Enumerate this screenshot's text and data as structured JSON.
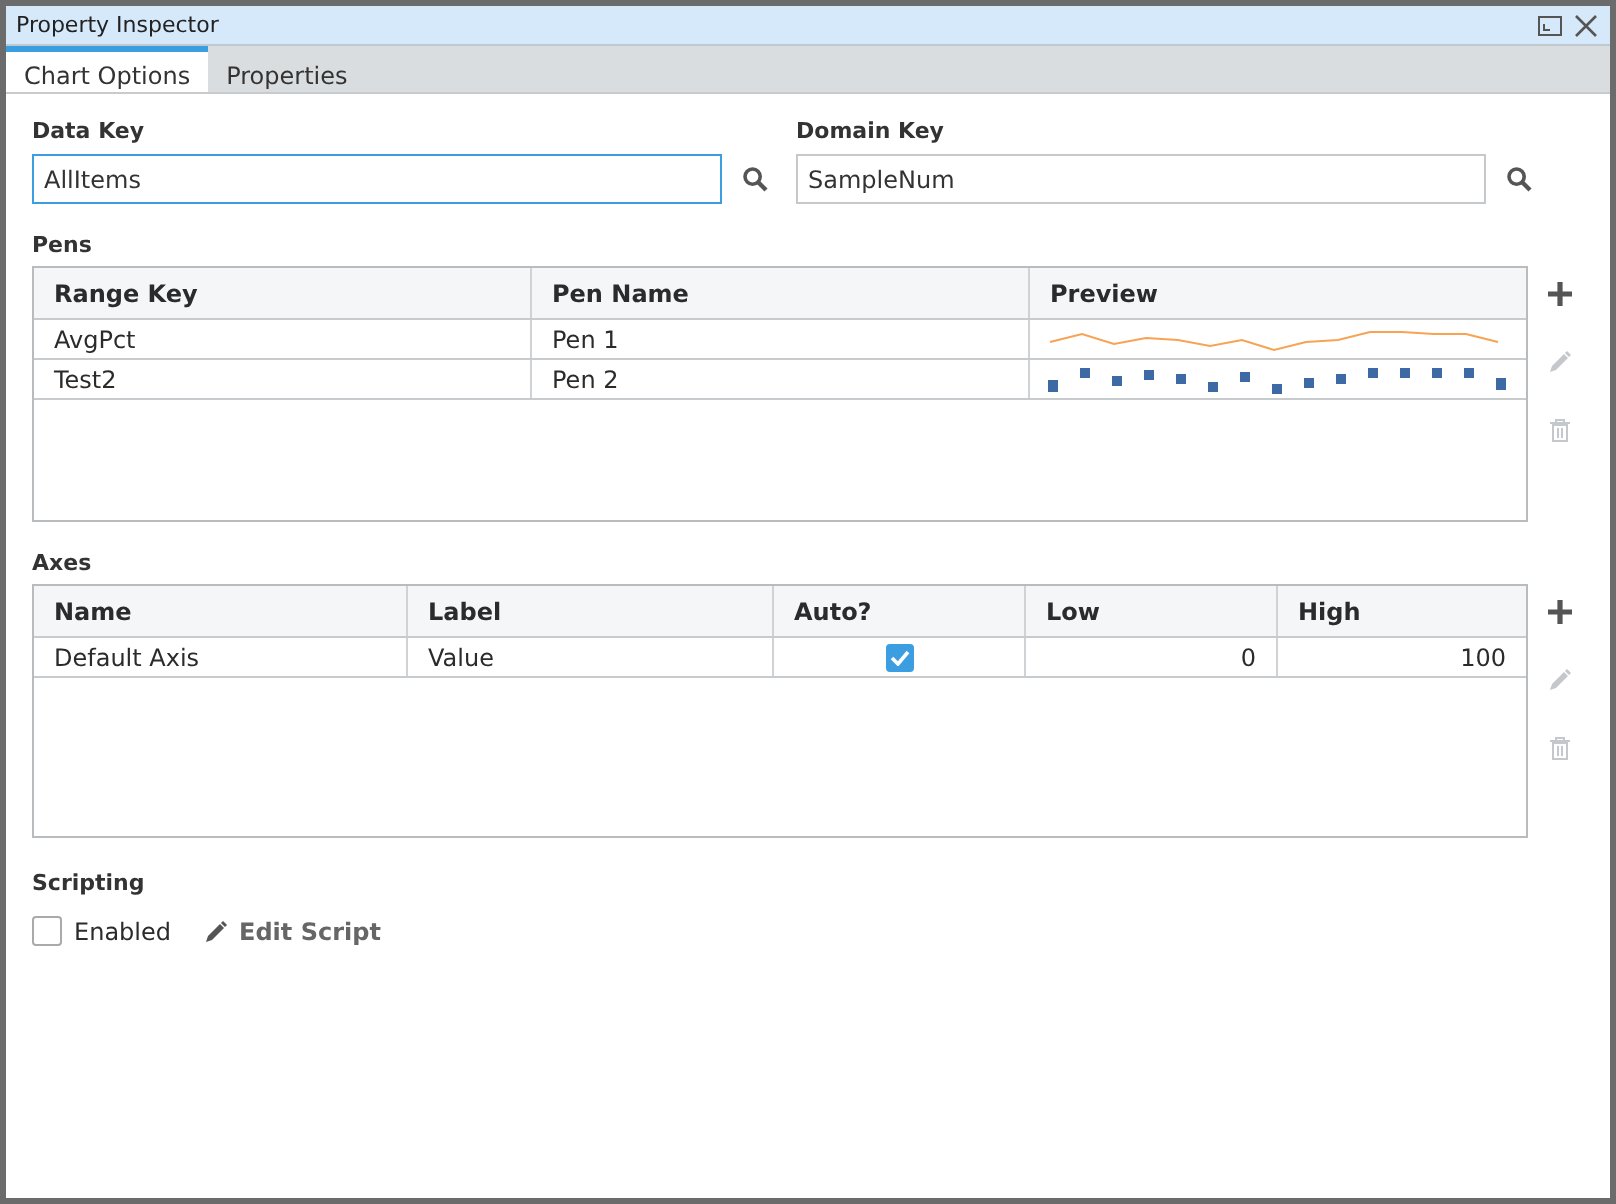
{
  "window": {
    "title": "Property Inspector"
  },
  "tabs": [
    {
      "label": "Chart Options",
      "selected": true
    },
    {
      "label": "Properties",
      "selected": false
    }
  ],
  "data_key": {
    "label": "Data Key",
    "value": "AllItems",
    "focused": true
  },
  "domain_key": {
    "label": "Domain Key",
    "value": "SampleNum",
    "focused": false
  },
  "pens": {
    "title": "Pens",
    "columns": [
      "Range Key",
      "Pen Name",
      "Preview"
    ],
    "rows": [
      {
        "range_key": "AvgPct",
        "pen_name": "Pen 1",
        "kind": "line",
        "color": "#f7a354"
      },
      {
        "range_key": "Test2",
        "pen_name": "Pen 2",
        "kind": "bar",
        "color": "#3d6aa4"
      }
    ],
    "actions": [
      {
        "kind": "add",
        "disabled": false
      },
      {
        "kind": "edit",
        "disabled": true
      },
      {
        "kind": "delete",
        "disabled": true
      }
    ]
  },
  "axes": {
    "title": "Axes",
    "columns": [
      "Name",
      "Label",
      "Auto?",
      "Low",
      "High"
    ],
    "rows": [
      {
        "name": "Default Axis",
        "label": "Value",
        "auto": true,
        "low": "0",
        "high": "100"
      }
    ],
    "actions": [
      {
        "kind": "add",
        "disabled": false
      },
      {
        "kind": "edit",
        "disabled": true
      },
      {
        "kind": "delete",
        "disabled": true
      }
    ]
  },
  "scripting": {
    "title": "Scripting",
    "enabled_label": "Enabled",
    "enabled": false,
    "edit_label": "Edit Script"
  }
}
